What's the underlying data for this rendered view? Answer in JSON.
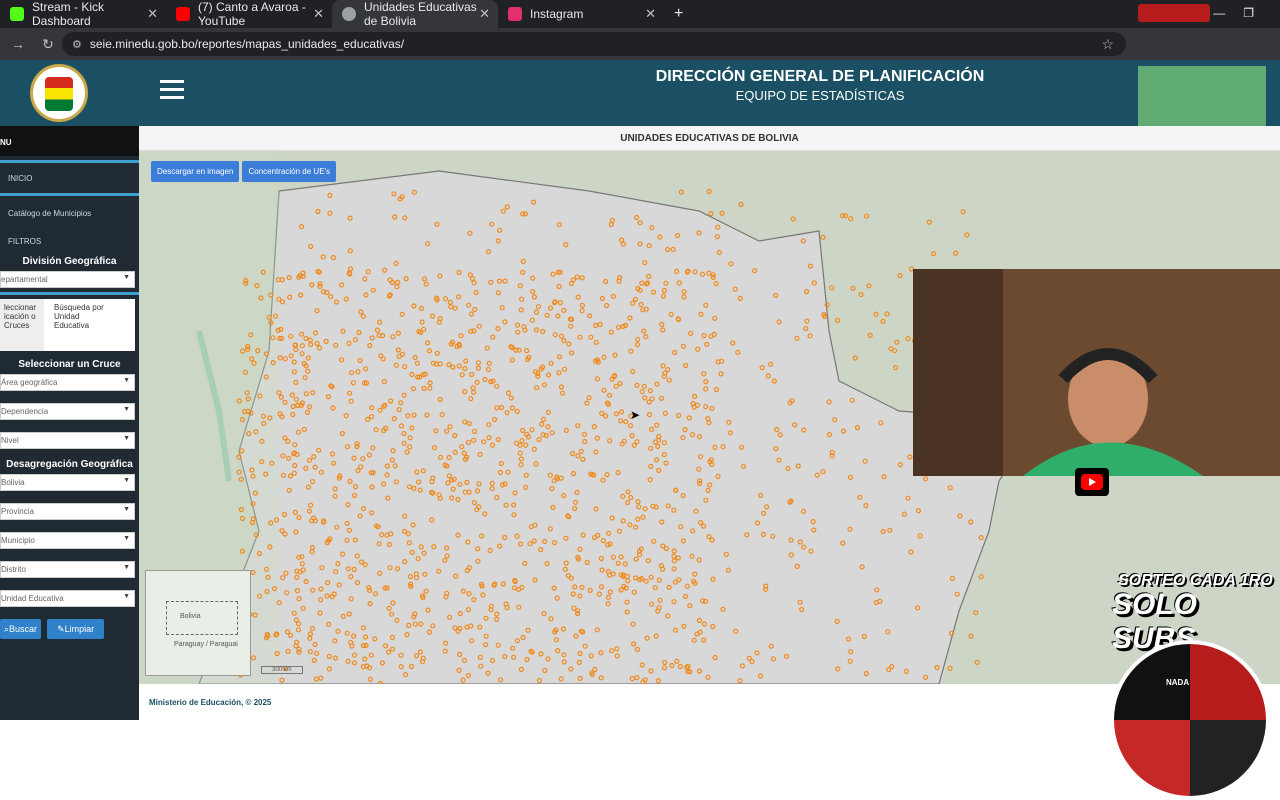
{
  "browser": {
    "tabs": [
      {
        "title": "Stream - Kick Dashboard",
        "color": "#53fc18"
      },
      {
        "title": "(7) Canto a Avaroa - YouTube",
        "color": "#ff0000"
      },
      {
        "title": "Unidades Educativas de Bolivia",
        "color": "#9aa0a6"
      },
      {
        "title": "Instagram",
        "color": "#e1306c"
      }
    ],
    "address": "seie.minedu.gob.bo/reportes/mapas_unidades_educativas/"
  },
  "header": {
    "title": "DIRECCIÓN GENERAL DE PLANIFICACIÓN",
    "subtitle": "EQUIPO DE ESTADÍSTICAS"
  },
  "sidebar": {
    "menu": "NU",
    "inicio": "INICIO",
    "catalogo": "Catálogo de Municipios",
    "filtros": "FILTROS",
    "division_title": "División Geográfica",
    "division_value": "epartamental",
    "tab1": "leccionar icación o Cruces",
    "tab2": "Búsqueda por Unidad Educativa",
    "cruce_title": "Seleccionar un Cruce",
    "cruce_selects": [
      "Área geográfica",
      "Dependencia",
      "Nivel"
    ],
    "desag_title": "Desagregación Geográfica",
    "desag_selects": [
      "Bolivia",
      "Provincia",
      "Municipio",
      "Distrito",
      "Unidad Educativa"
    ],
    "buscar": "Buscar",
    "limpiar": "Limpiar"
  },
  "map": {
    "title": "UNIDADES EDUCATIVAS DE BOLIVIA",
    "btn_download": "Descargar en imagen",
    "btn_concentration": "Concentración de UE's",
    "minimap_label": "Bolivia",
    "minimap_country": "Paraguay / Paraguai",
    "scale": "300 km"
  },
  "footer": "Ministerio de Educación, © 2025",
  "overlay": {
    "promo_line1": "SORTEO CADA 1RO",
    "promo_line2": "SOLO SUBS",
    "wheel_label": "NADA"
  }
}
